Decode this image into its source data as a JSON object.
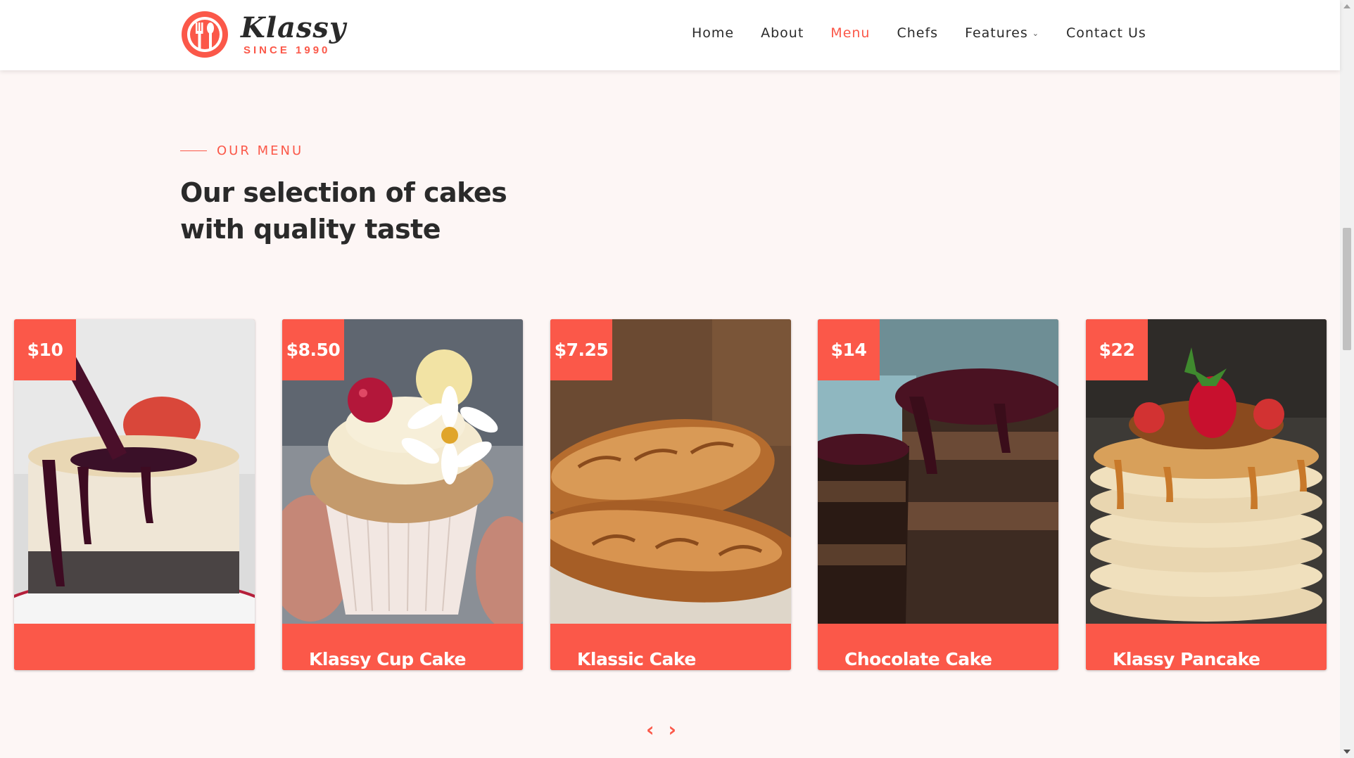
{
  "brand": {
    "name": "Klassy",
    "tagline": "SINCE 1990",
    "accent_color": "#fb5849",
    "logo_icon": "fork-spoon-plate-icon"
  },
  "nav": {
    "items": [
      {
        "label": "Home",
        "active": false
      },
      {
        "label": "About",
        "active": false
      },
      {
        "label": "Menu",
        "active": true
      },
      {
        "label": "Chefs",
        "active": false
      },
      {
        "label": "Features",
        "active": false,
        "has_dropdown": true
      },
      {
        "label": "Contact Us",
        "active": false
      }
    ]
  },
  "section": {
    "eyebrow": "OUR MENU",
    "title_line1": "Our selection of cakes",
    "title_line2": "with quality taste"
  },
  "menu": {
    "items": [
      {
        "price": "$10",
        "title": "",
        "image": "cheesecake-with-berry-sauce"
      },
      {
        "price": "$8.50",
        "title": "Klassy Cup Cake",
        "image": "cupcake-with-raspberry-and-flower"
      },
      {
        "price": "$7.25",
        "title": "Klassic Cake",
        "image": "baguette-bread-loaves"
      },
      {
        "price": "$14",
        "title": "Chocolate Cake",
        "image": "chocolate-layer-cake-slice"
      },
      {
        "price": "$22",
        "title": "Klassy Pancake",
        "image": "pancake-stack-with-strawberry"
      }
    ]
  },
  "carousel": {
    "prev_icon": "chevron-left-icon",
    "next_icon": "chevron-right-icon"
  }
}
